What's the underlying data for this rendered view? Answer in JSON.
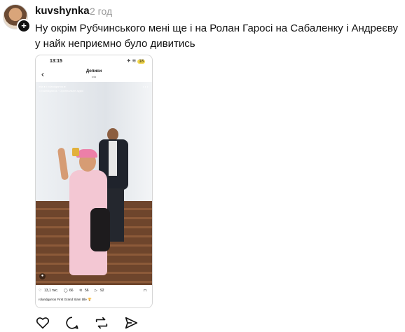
{
  "post": {
    "username": "kuvshynka",
    "timestamp": "2 год",
    "text": "Ну окрім Рубчинського мені ще і на Ролан Гаросі на Сабаленку і Андреєву у найк неприємно було дивитись"
  },
  "screenshot": {
    "status_time": "13:15",
    "battery": "18",
    "nav_title": "Допиcи",
    "nav_sub": "wta",
    "video_header_line1": "wta ● і rolandgarros ●",
    "video_header_line2": "♫ rolandgarros · Оригінальне аудіо",
    "likes": "13,1 тис.",
    "comments": "66",
    "reposts": "56",
    "shares": "92",
    "caption": "rolandgarros First Grand Slam title 🏆"
  },
  "icons": {
    "like": "heart-icon",
    "comment": "comment-icon",
    "repost": "repost-icon",
    "share": "send-icon"
  }
}
